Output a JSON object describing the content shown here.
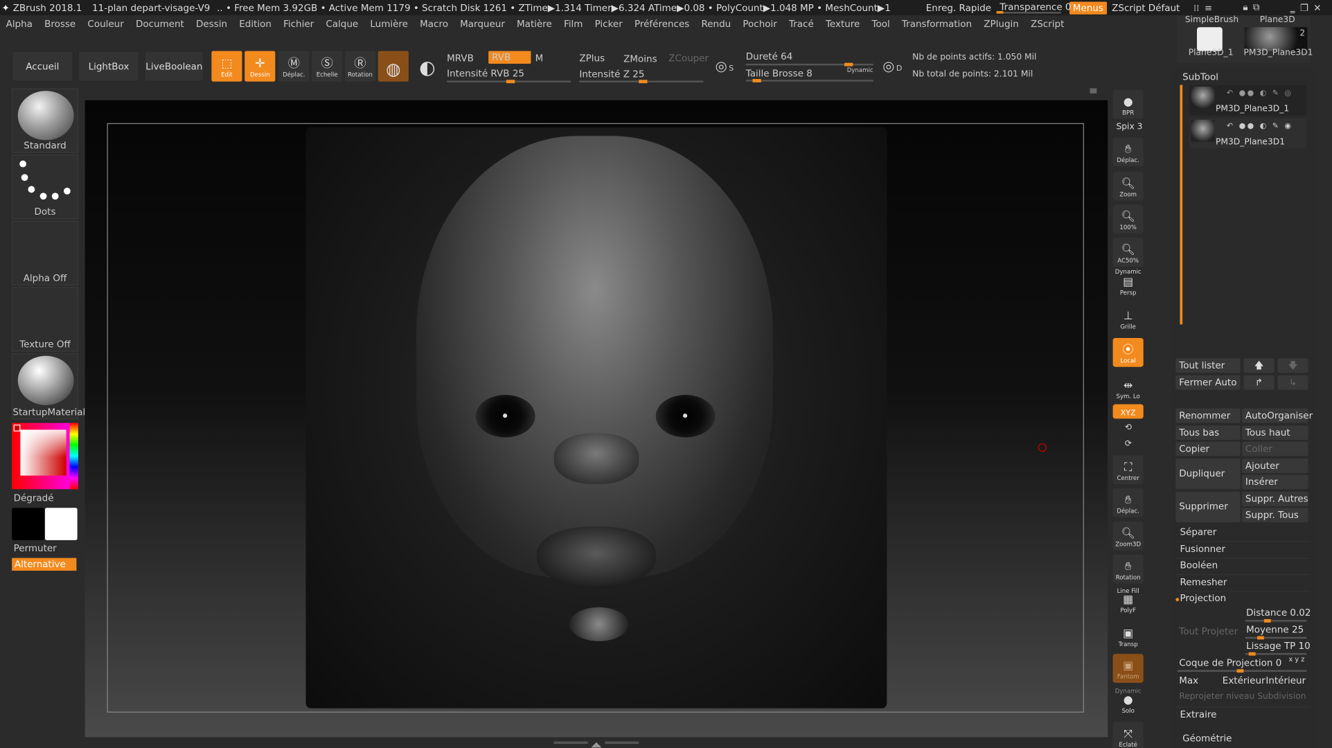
{
  "titlebar": {
    "app": "ZBrush 2018.1",
    "doc": "11-plan depart-visage-V9",
    "stats": ".. • Free Mem 3.92GB • Active Mem 1179 • Scratch Disk 1261 • ZTime▶1.314 Timer▶6.324 ATime▶0.08 • PolyCount▶1.048 MP • MeshCount▶1",
    "quicksave": "Enreg. Rapide",
    "transparence": "Transparence 0",
    "transparence_value": 0,
    "menus": "Menus",
    "zscript": "ZScript Défaut",
    "icons": [
      "layout-icon",
      "ui-icon",
      "lock-icon",
      "window-icon",
      "minimize-icon",
      "restore-icon",
      "close-icon"
    ]
  },
  "menubar": [
    "Alpha",
    "Brosse",
    "Couleur",
    "Document",
    "Dessin",
    "Edition",
    "Fichier",
    "Calque",
    "Lumière",
    "Macro",
    "Marqueur",
    "Matière",
    "Film",
    "Picker",
    "Préférences",
    "Rendu",
    "Pochoir",
    "Tracé",
    "Texture",
    "Tool",
    "Transformation",
    "ZPlugin",
    "ZScript"
  ],
  "toolbar": {
    "accueil": "Accueil",
    "lightbox": "LightBox",
    "liveboolean": "LiveBoolean",
    "edit": "Edit",
    "dessin": "Dessin",
    "deplac": "Déplac.",
    "echelle": "Echelle",
    "rotation": "Rotation",
    "mrvb": "MRVB",
    "rvb": "RVB",
    "m": "M",
    "intensite_rvb": "Intensité RVB 25",
    "intensite_rvb_value": 25,
    "zplus": "ZPlus",
    "zmoins": "ZMoins",
    "zcouper": "ZCouper",
    "intensite_z": "Intensité Z 25",
    "intensite_z_value": 25,
    "durete": "Dureté 64",
    "durete_value": 64,
    "taille": "Taille Brosse 8",
    "taille_value": 8,
    "dynamic": "Dynamic",
    "s_label": "S",
    "d_label": "D",
    "points_actifs": "Nb de points actifs: 1.050 Mil",
    "points_total": "Nb total de points: 2.101 Mil"
  },
  "leftshelf": {
    "standard": "Standard",
    "dots": "Dots",
    "alpha": "Alpha Off",
    "texture": "Texture Off",
    "material": "StartupMaterial",
    "degrade": "Dégradé",
    "permuter": "Permuter",
    "alternative": "Alternative",
    "primary_color": "#000000",
    "secondary_color": "#ffffff"
  },
  "rcol": {
    "bpr": "BPR",
    "spix": "Spix 3",
    "deplac": "Déplac.",
    "zoom": "Zoom",
    "zoom100": "100%",
    "ac50": "AC50%",
    "dynamic": "Dynamic",
    "persp": "Persp",
    "grille": "Grille",
    "local": "Local",
    "symlo": "Sym. Lo",
    "xyz": "XYZ",
    "centrer": "Centrer",
    "deplac2": "Déplac.",
    "zoom3d": "Zoom3D",
    "rotation": "Rotation",
    "linefill": "Line Fill",
    "polyf": "PolyF",
    "transp": "Transp",
    "fantom": "Fantom",
    "dynamic2": "Dynamic",
    "solo": "Solo",
    "eclate": "Eclaté"
  },
  "traytop": {
    "simplebrush": "SimpleBrush",
    "plane3d": "Plane3D",
    "plane3d_1": "Plane3D_1",
    "pm3d": "PM3D_Plane3D1",
    "count": "2"
  },
  "subtool": {
    "title": "SubTool",
    "items": [
      "PM3D_Plane3D_1",
      "PM3D_Plane3D1"
    ],
    "tout_lister": "Tout lister",
    "fermer_auto": "Fermer Auto",
    "renommer": "Renommer",
    "autoorganiser": "AutoOrganiser",
    "tous_bas": "Tous bas",
    "tous_haut": "Tous haut",
    "copier": "Copier",
    "coller": "Coller",
    "dupliquer": "Dupliquer",
    "ajouter": "Ajouter",
    "inserer": "Insérer",
    "supprimer": "Supprimer",
    "suppr_autres": "Suppr. Autres",
    "suppr_tous": "Suppr. Tous",
    "separer": "Séparer",
    "fusionner": "Fusionner",
    "booleen": "Booléen",
    "remesher": "Remesher",
    "projection": "Projection",
    "tout_projeter": "Tout Projeter",
    "distance": "Distance 0.02",
    "distance_value": 0.02,
    "moyenne": "Moyenne 25",
    "moyenne_value": 25,
    "lissage": "Lissage TP 10",
    "lissage_value": 10,
    "coque": "Coque de Projection 0",
    "coque_value": 0,
    "coque_axes": "x y z",
    "max": "Max",
    "exterieur": "Extérieur",
    "interieur": "Intérieur",
    "reprojeter": "Reprojeter niveau Subdivision",
    "extraire": "Extraire",
    "geometrie": "Géométrie"
  }
}
